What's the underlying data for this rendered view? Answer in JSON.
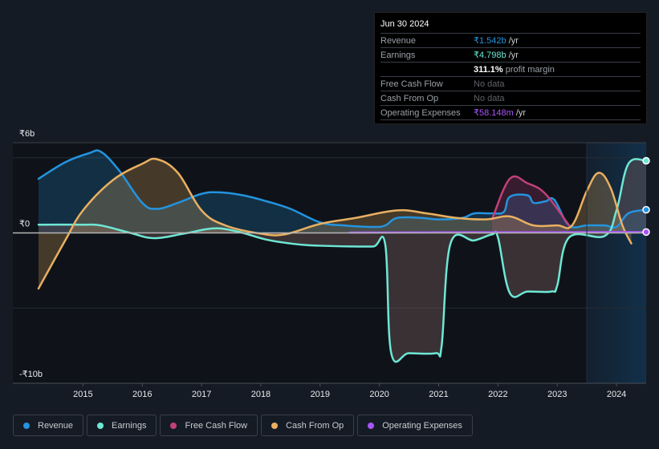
{
  "tooltip": {
    "date": "Jun 30 2024",
    "rows": [
      {
        "label": "Revenue",
        "value": "₹1.542b",
        "unit": " /yr",
        "color": "#2394df"
      },
      {
        "label": "Earnings",
        "value": "₹4.798b",
        "unit": " /yr",
        "color": "#6ee7d5"
      },
      {
        "label": "",
        "value": "311.1%",
        "unit": " profit margin",
        "color": "#ffffff"
      },
      {
        "label": "Free Cash Flow",
        "value": "No data",
        "unit": "",
        "color": "#5f6368"
      },
      {
        "label": "Cash From Op",
        "value": "No data",
        "unit": "",
        "color": "#5f6368"
      },
      {
        "label": "Operating Expenses",
        "value": "₹58.148m",
        "unit": " /yr",
        "color": "#a855f7"
      }
    ]
  },
  "legend": [
    {
      "label": "Revenue",
      "color": "#2394df"
    },
    {
      "label": "Earnings",
      "color": "#6ee7d5"
    },
    {
      "label": "Free Cash Flow",
      "color": "#c2407a"
    },
    {
      "label": "Cash From Op",
      "color": "#e9b061"
    },
    {
      "label": "Operating Expenses",
      "color": "#a855f7"
    }
  ],
  "chart_data": {
    "type": "area",
    "title": "",
    "xlabel": "",
    "ylabel": "",
    "xlim": [
      2014.25,
      2024.5
    ],
    "ylim": [
      -10,
      6
    ],
    "y_ticks": [
      {
        "value": 6,
        "label": "₹6b"
      },
      {
        "value": 0,
        "label": "₹0"
      },
      {
        "value": -10,
        "label": "-₹10b"
      }
    ],
    "gridlines": [
      5,
      0,
      -5
    ],
    "x_ticks": [
      2015,
      2016,
      2017,
      2018,
      2019,
      2020,
      2021,
      2022,
      2023,
      2024
    ],
    "highlight_from": 2023.5,
    "units": "₹ billions",
    "series": [
      {
        "name": "Revenue",
        "color": "#2394df",
        "x": [
          2014.25,
          2014.7,
          2015.1,
          2015.3,
          2015.6,
          2016.0,
          2016.25,
          2016.6,
          2017.0,
          2017.3,
          2017.7,
          2018.1,
          2018.5,
          2019.0,
          2019.4,
          2019.9,
          2020.1,
          2020.3,
          2020.7,
          2021.0,
          2021.4,
          2021.6,
          2021.9,
          2022.1,
          2022.2,
          2022.5,
          2022.6,
          2022.8,
          2022.95,
          2023.2,
          2023.5,
          2023.8,
          2024.0,
          2024.2,
          2024.5
        ],
        "values": [
          3.6,
          4.7,
          5.3,
          5.4,
          4.2,
          2.0,
          1.6,
          2.0,
          2.6,
          2.7,
          2.5,
          2.1,
          1.6,
          0.7,
          0.5,
          0.4,
          0.5,
          1.0,
          1.0,
          0.9,
          1.0,
          1.3,
          1.3,
          1.4,
          2.4,
          2.5,
          2.0,
          2.1,
          2.2,
          0.5,
          0.5,
          0.5,
          0.4,
          1.3,
          1.54
        ]
      },
      {
        "name": "Earnings",
        "color": "#6ee7d5",
        "x": [
          2014.25,
          2015.0,
          2015.3,
          2015.8,
          2016.2,
          2016.7,
          2017.2,
          2017.6,
          2018.1,
          2018.6,
          2019.0,
          2019.5,
          2019.9,
          2020.1,
          2020.2,
          2020.5,
          2020.95,
          2021.05,
          2021.2,
          2021.6,
          2021.9,
          2022.0,
          2022.2,
          2022.5,
          2022.9,
          2023.0,
          2023.2,
          2023.8,
          2024.0,
          2024.2,
          2024.5
        ],
        "values": [
          0.55,
          0.55,
          0.5,
          0.0,
          -0.35,
          -0.05,
          0.3,
          0.1,
          -0.45,
          -0.75,
          -0.85,
          -0.9,
          -0.9,
          -0.8,
          -8.0,
          -8.0,
          -8.0,
          -7.5,
          -0.7,
          -0.5,
          -0.1,
          -0.3,
          -4.0,
          -3.9,
          -3.9,
          -3.5,
          -0.3,
          -0.2,
          1.5,
          4.6,
          4.8
        ]
      },
      {
        "name": "Free Cash Flow",
        "color": "#c2407a",
        "x": [
          2021.9,
          2022.2,
          2022.5,
          2022.8,
          2023.2
        ],
        "values": [
          0.9,
          3.6,
          3.3,
          2.6,
          0.5
        ]
      },
      {
        "name": "Cash From Op",
        "color": "#e9b061",
        "x": [
          2014.25,
          2014.7,
          2015.0,
          2015.5,
          2016.0,
          2016.25,
          2016.6,
          2017.0,
          2017.4,
          2018.0,
          2018.4,
          2019.0,
          2019.6,
          2020.3,
          2020.8,
          2021.3,
          2021.8,
          2022.2,
          2022.6,
          2023.0,
          2023.25,
          2023.5,
          2023.7,
          2023.9,
          2024.1,
          2024.25
        ],
        "values": [
          -3.7,
          -0.5,
          1.5,
          3.5,
          4.6,
          4.9,
          4.0,
          1.5,
          0.5,
          -0.05,
          -0.1,
          0.6,
          1.0,
          1.5,
          1.3,
          1.0,
          0.9,
          1.1,
          0.5,
          0.5,
          0.5,
          2.8,
          4.0,
          3.0,
          0.5,
          -0.7
        ]
      },
      {
        "name": "Operating Expenses",
        "color": "#a855f7",
        "x": [
          2019.5,
          2021.0,
          2022.0,
          2023.0,
          2024.0,
          2024.5
        ],
        "values": [
          0.03,
          0.04,
          0.05,
          0.05,
          0.06,
          0.058
        ]
      }
    ]
  }
}
